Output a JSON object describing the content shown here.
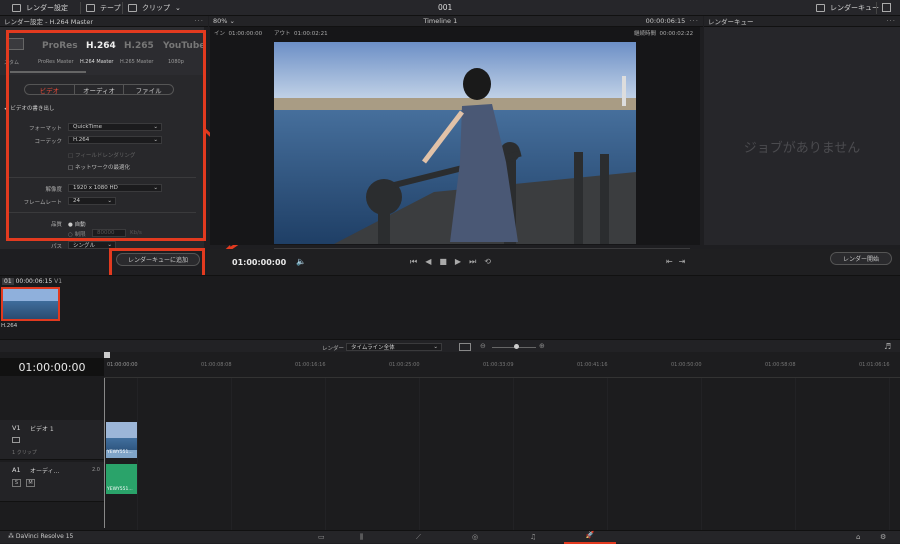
{
  "topbar": {
    "render_settings": "レンダー設定",
    "tape": "テープ",
    "clip": "クリップ",
    "project_title": "001",
    "render_queue": "レンダーキュー"
  },
  "panel": {
    "title": "レンダー設定 - H.264 Master",
    "zoom": "80%",
    "timeline_name": "Timeline 1",
    "timecode_total": "00:00:06:15",
    "queue_title": "レンダーキュー"
  },
  "presets": {
    "items": [
      {
        "name": "",
        "label": "スタム"
      },
      {
        "name": "ProRes",
        "label": "ProRes Master"
      },
      {
        "name": "H.264",
        "label": "H.264 Master"
      },
      {
        "name": "H.265",
        "label": "H.265 Master"
      },
      {
        "name": "YouTube",
        "label": "1080p"
      }
    ]
  },
  "tabs": [
    "ビデオ",
    "オーディオ",
    "ファイル"
  ],
  "video": {
    "export_video": "ビデオの書き出し",
    "format_label": "フォーマット",
    "format_value": "QuickTime",
    "codec_label": "コーデック",
    "codec_value": "H.264",
    "field_render": "フィールドレンダリング",
    "network_opt": "ネットワークの最適化",
    "resolution_label": "解像度",
    "resolution_value": "1920 x 1080 HD",
    "framerate_label": "フレームレート",
    "framerate_value": "24",
    "quality_label": "品質",
    "auto": "自動",
    "limit": "制限",
    "limit_value": "80000",
    "limit_unit": "Kb/s",
    "pass_label": "パス",
    "pass_value": "シングル"
  },
  "viewer": {
    "in_label": "イン",
    "in_tc": "01:00:00:00",
    "out_label": "アウト",
    "out_tc": "01:00:02:21",
    "duration_label": "継続時間",
    "duration_tc": "00:00:02:22",
    "current_tc": "01:00:00:00"
  },
  "queue": {
    "empty": "ジョブがありません",
    "start": "レンダー開始"
  },
  "add_queue": "レンダーキューに追加",
  "clips": {
    "index": "01",
    "tc": "00:00:06:15",
    "track": "V1",
    "clip_name": "H.264"
  },
  "render_bar": {
    "label": "レンダー",
    "value": "タイムライン全体"
  },
  "timeline": {
    "timecode": "01:00:00:00",
    "ruler": [
      "01:00:00:00",
      "01:00:08:08",
      "01:00:16:16",
      "01:00:25:00",
      "01:00:33:09",
      "01:00:41:16",
      "01:00:50:00",
      "01:00:58:08",
      "01:01:06:16"
    ],
    "v1": "V1",
    "v1_name": "ビデオ 1",
    "v1_clips": "1 クリップ",
    "a1": "A1",
    "a1_name": "オーディ...",
    "a1_level": "2.0",
    "clip_label": "YEWY551...",
    "s": "S",
    "m": "M"
  },
  "status": {
    "app": "DaVinci Resolve 15"
  },
  "colors": {
    "accent": "#e23a1f",
    "audio_clip": "#2aa36a"
  }
}
